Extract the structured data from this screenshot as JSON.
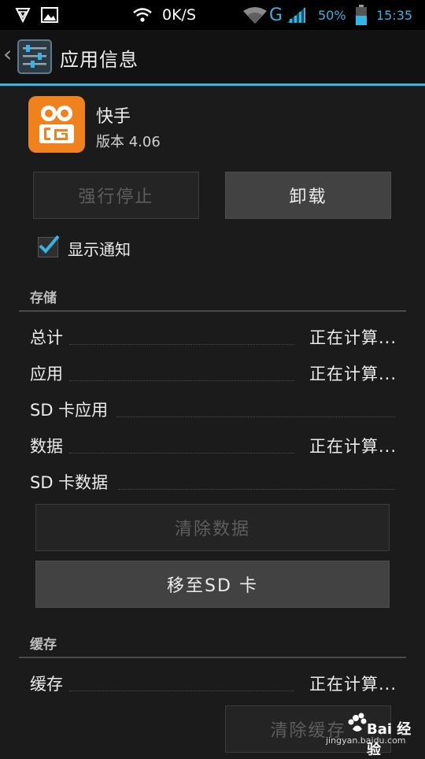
{
  "status_bar": {
    "speed": "0K/S",
    "network": "G",
    "battery": "50%",
    "time": "15:35"
  },
  "action_bar": {
    "title": "应用信息"
  },
  "app": {
    "name": "快手",
    "version": "版本 4.06",
    "icon": "kuaishou-app-icon",
    "icon_color": "#f0821e"
  },
  "buttons": {
    "force_stop": "强行停止",
    "uninstall": "卸载",
    "clear_data": "清除数据",
    "move_to_sd": "移至SD 卡",
    "clear_cache": "清除缓存"
  },
  "notifications": {
    "label": "显示通知",
    "checked": true
  },
  "storage": {
    "header": "存储",
    "rows": [
      {
        "label": "总计",
        "value": "正在计算..."
      },
      {
        "label": "应用",
        "value": "正在计算..."
      },
      {
        "label": "SD 卡应用",
        "value": ""
      },
      {
        "label": "数据",
        "value": "正在计算..."
      },
      {
        "label": "SD 卡数据",
        "value": ""
      }
    ]
  },
  "cache": {
    "header": "缓存",
    "rows": [
      {
        "label": "缓存",
        "value": "正在计算..."
      }
    ]
  },
  "watermark": {
    "brand": "Bai 经验",
    "url": "jingyan.baidu.com"
  },
  "colors": {
    "accent": "#33b5e5",
    "background": "#1b1b1b"
  }
}
